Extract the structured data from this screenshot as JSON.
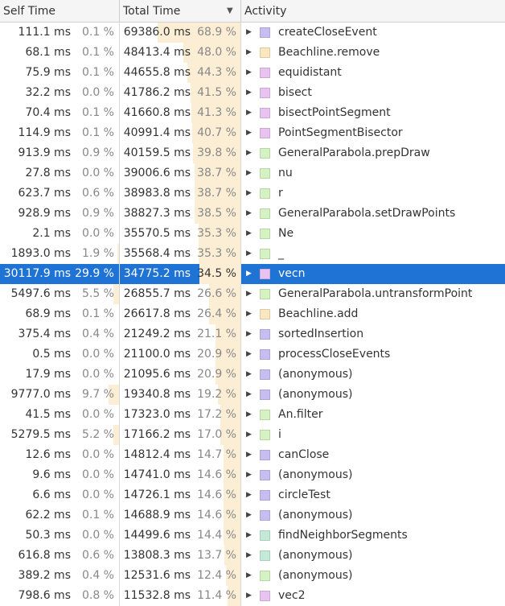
{
  "headers": {
    "self": "Self Time",
    "total": "Total Time",
    "activity": "Activity"
  },
  "colors": {
    "purple": "#c7bdf0",
    "tan": "#fae6bf",
    "pink": "#e8c3f2",
    "green": "#d4f2c2",
    "teal": "#c3ead7",
    "selected": "#1e73d4",
    "bar": "#fbeed4"
  },
  "rows": [
    {
      "self_ms": "111.1 ms",
      "self_pct": "0.1 %",
      "total_ms": "69386.0 ms",
      "total_pct": "68.9 %",
      "name": "createCloseEvent",
      "color": "purple"
    },
    {
      "self_ms": "68.1 ms",
      "self_pct": "0.1 %",
      "total_ms": "48413.4 ms",
      "total_pct": "48.0 %",
      "name": "Beachline.remove",
      "color": "tan"
    },
    {
      "self_ms": "75.9 ms",
      "self_pct": "0.1 %",
      "total_ms": "44655.8 ms",
      "total_pct": "44.3 %",
      "name": "equidistant",
      "color": "pink"
    },
    {
      "self_ms": "32.2 ms",
      "self_pct": "0.0 %",
      "total_ms": "41786.2 ms",
      "total_pct": "41.5 %",
      "name": "bisect",
      "color": "pink"
    },
    {
      "self_ms": "70.4 ms",
      "self_pct": "0.1 %",
      "total_ms": "41660.8 ms",
      "total_pct": "41.3 %",
      "name": "bisectPointSegment",
      "color": "pink"
    },
    {
      "self_ms": "114.9 ms",
      "self_pct": "0.1 %",
      "total_ms": "40991.4 ms",
      "total_pct": "40.7 %",
      "name": "PointSegmentBisector",
      "color": "pink"
    },
    {
      "self_ms": "913.9 ms",
      "self_pct": "0.9 %",
      "total_ms": "40159.5 ms",
      "total_pct": "39.8 %",
      "name": "GeneralParabola.prepDraw",
      "color": "green"
    },
    {
      "self_ms": "27.8 ms",
      "self_pct": "0.0 %",
      "total_ms": "39006.6 ms",
      "total_pct": "38.7 %",
      "name": "nu",
      "color": "green"
    },
    {
      "self_ms": "623.7 ms",
      "self_pct": "0.6 %",
      "total_ms": "38983.8 ms",
      "total_pct": "38.7 %",
      "name": "r",
      "color": "green"
    },
    {
      "self_ms": "928.9 ms",
      "self_pct": "0.9 %",
      "total_ms": "38827.3 ms",
      "total_pct": "38.5 %",
      "name": "GeneralParabola.setDrawPoints",
      "color": "green"
    },
    {
      "self_ms": "2.1 ms",
      "self_pct": "0.0 %",
      "total_ms": "35570.5 ms",
      "total_pct": "35.3 %",
      "name": "Ne",
      "color": "green"
    },
    {
      "self_ms": "1893.0 ms",
      "self_pct": "1.9 %",
      "total_ms": "35568.4 ms",
      "total_pct": "35.3 %",
      "name": "_",
      "color": "green"
    },
    {
      "self_ms": "30117.9 ms",
      "self_pct": "29.9 %",
      "total_ms": "34775.2 ms",
      "total_pct": "34.5 %",
      "name": "vecn",
      "color": "pink",
      "selected": true
    },
    {
      "self_ms": "5497.6 ms",
      "self_pct": "5.5 %",
      "total_ms": "26855.7 ms",
      "total_pct": "26.6 %",
      "name": "GeneralParabola.untransformPoint",
      "color": "green"
    },
    {
      "self_ms": "68.9 ms",
      "self_pct": "0.1 %",
      "total_ms": "26617.8 ms",
      "total_pct": "26.4 %",
      "name": "Beachline.add",
      "color": "tan"
    },
    {
      "self_ms": "375.4 ms",
      "self_pct": "0.4 %",
      "total_ms": "21249.2 ms",
      "total_pct": "21.1 %",
      "name": "sortedInsertion",
      "color": "purple"
    },
    {
      "self_ms": "0.5 ms",
      "self_pct": "0.0 %",
      "total_ms": "21100.0 ms",
      "total_pct": "20.9 %",
      "name": "processCloseEvents",
      "color": "purple"
    },
    {
      "self_ms": "17.9 ms",
      "self_pct": "0.0 %",
      "total_ms": "21095.6 ms",
      "total_pct": "20.9 %",
      "name": "(anonymous)",
      "color": "purple"
    },
    {
      "self_ms": "9777.0 ms",
      "self_pct": "9.7 %",
      "total_ms": "19340.8 ms",
      "total_pct": "19.2 %",
      "name": "(anonymous)",
      "color": "purple"
    },
    {
      "self_ms": "41.5 ms",
      "self_pct": "0.0 %",
      "total_ms": "17323.0 ms",
      "total_pct": "17.2 %",
      "name": "An.filter",
      "color": "green"
    },
    {
      "self_ms": "5279.5 ms",
      "self_pct": "5.2 %",
      "total_ms": "17166.2 ms",
      "total_pct": "17.0 %",
      "name": "i",
      "color": "green"
    },
    {
      "self_ms": "12.6 ms",
      "self_pct": "0.0 %",
      "total_ms": "14812.4 ms",
      "total_pct": "14.7 %",
      "name": "canClose",
      "color": "purple"
    },
    {
      "self_ms": "9.6 ms",
      "self_pct": "0.0 %",
      "total_ms": "14741.0 ms",
      "total_pct": "14.6 %",
      "name": "(anonymous)",
      "color": "purple"
    },
    {
      "self_ms": "6.6 ms",
      "self_pct": "0.0 %",
      "total_ms": "14726.1 ms",
      "total_pct": "14.6 %",
      "name": "circleTest",
      "color": "purple"
    },
    {
      "self_ms": "62.2 ms",
      "self_pct": "0.1 %",
      "total_ms": "14688.9 ms",
      "total_pct": "14.6 %",
      "name": "(anonymous)",
      "color": "purple"
    },
    {
      "self_ms": "50.3 ms",
      "self_pct": "0.0 %",
      "total_ms": "14499.6 ms",
      "total_pct": "14.4 %",
      "name": "findNeighborSegments",
      "color": "teal"
    },
    {
      "self_ms": "616.8 ms",
      "self_pct": "0.6 %",
      "total_ms": "13808.3 ms",
      "total_pct": "13.7 %",
      "name": "(anonymous)",
      "color": "teal"
    },
    {
      "self_ms": "389.2 ms",
      "self_pct": "0.4 %",
      "total_ms": "12531.6 ms",
      "total_pct": "12.4 %",
      "name": "(anonymous)",
      "color": "green"
    },
    {
      "self_ms": "798.6 ms",
      "self_pct": "0.8 %",
      "total_ms": "11532.8 ms",
      "total_pct": "11.4 %",
      "name": "vec2",
      "color": "pink"
    }
  ]
}
